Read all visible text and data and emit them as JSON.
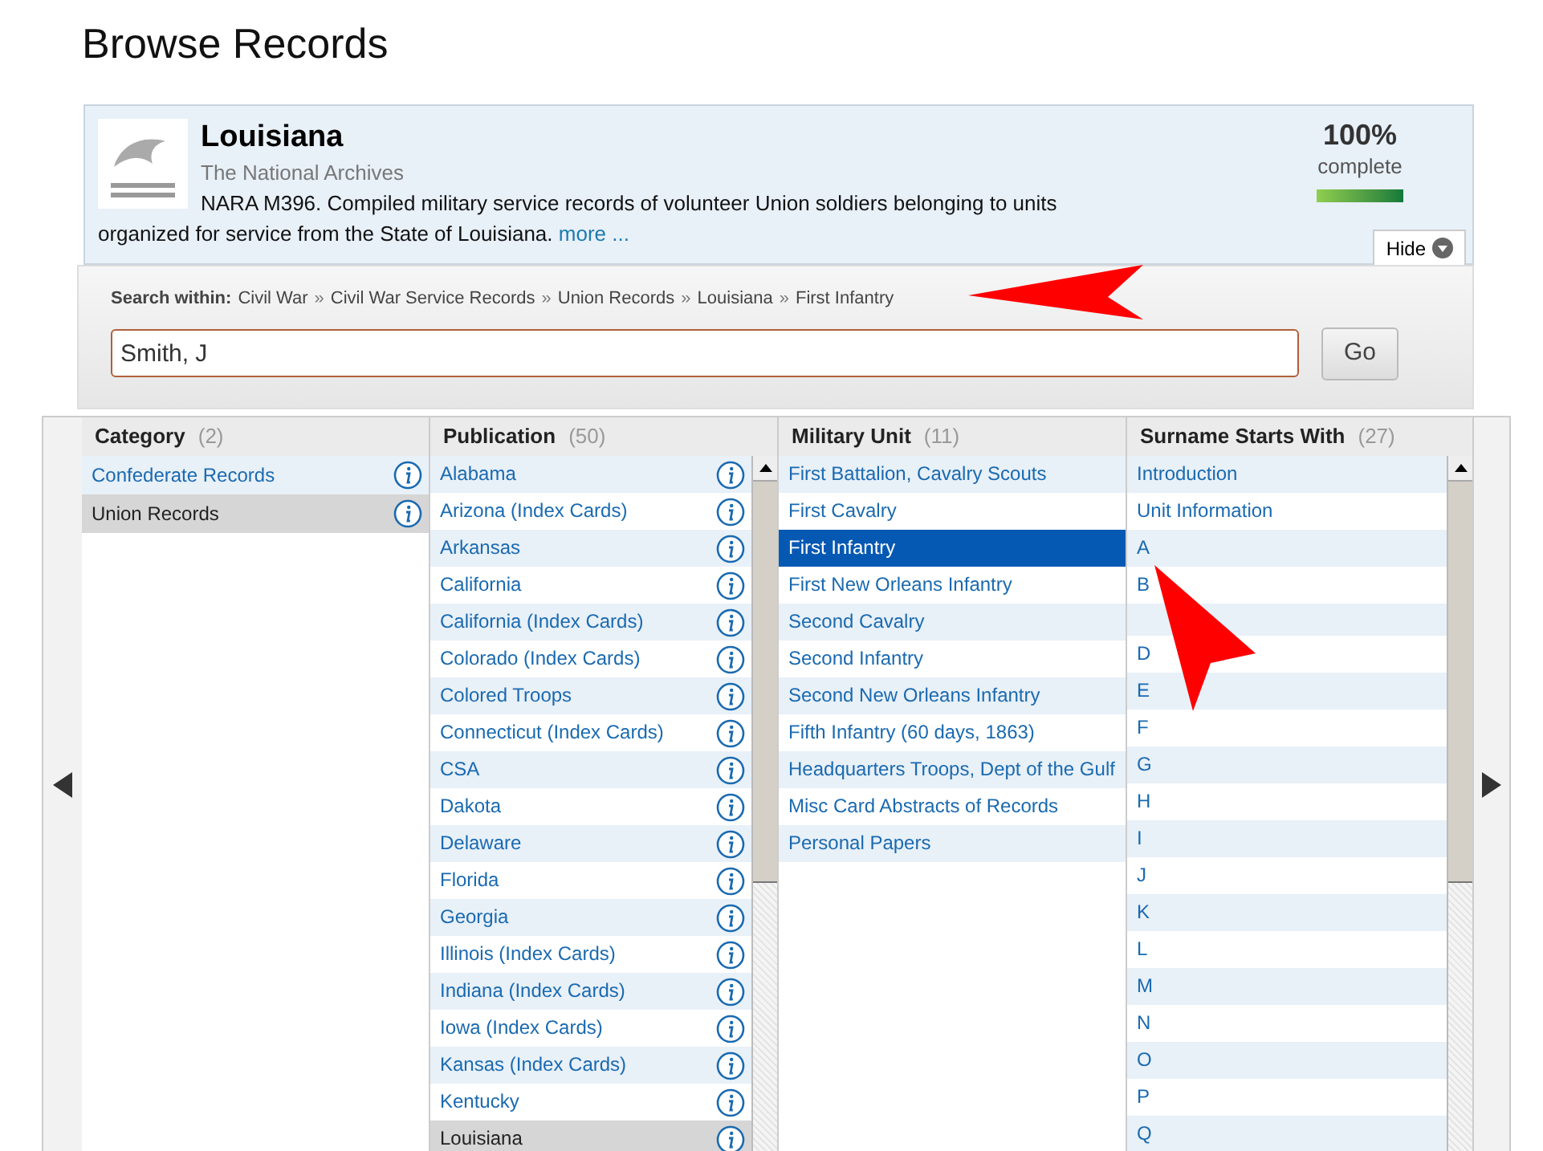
{
  "page_title": "Browse Records",
  "collection": {
    "title": "Louisiana",
    "publisher": "The National Archives",
    "description": "NARA M396. Compiled military service records of volunteer Union soldiers belonging to units organized for service from the State of Louisiana.",
    "more_link": "more ...",
    "percent": "100%",
    "percent_label": "complete",
    "level": 1,
    "hide_button": "Hide"
  },
  "search": {
    "label": "Search within:",
    "breadcrumbs": [
      "Civil War",
      "Civil War Service Records",
      "Union Records",
      "Louisiana",
      "First Infantry"
    ],
    "separator": "»",
    "value": "Smith, J",
    "button": "Go"
  },
  "columns": [
    {
      "title": "Category",
      "count": "(2)",
      "info": true,
      "items": [
        {
          "label": "Confederate Records",
          "selected": false
        },
        {
          "label": "Union Records",
          "selected": true
        }
      ]
    },
    {
      "title": "Publication",
      "count": "(50)",
      "info": true,
      "scrollbar": true,
      "items": [
        {
          "label": "Alabama",
          "selected": false
        },
        {
          "label": "Arizona (Index Cards)",
          "selected": false
        },
        {
          "label": "Arkansas",
          "selected": false
        },
        {
          "label": "California",
          "selected": false
        },
        {
          "label": "California (Index Cards)",
          "selected": false
        },
        {
          "label": "Colorado (Index Cards)",
          "selected": false
        },
        {
          "label": "Colored Troops",
          "selected": false
        },
        {
          "label": "Connecticut (Index Cards)",
          "selected": false
        },
        {
          "label": "CSA",
          "selected": false
        },
        {
          "label": "Dakota",
          "selected": false
        },
        {
          "label": "Delaware",
          "selected": false
        },
        {
          "label": "Florida",
          "selected": false
        },
        {
          "label": "Georgia",
          "selected": false
        },
        {
          "label": "Illinois (Index Cards)",
          "selected": false
        },
        {
          "label": "Indiana (Index Cards)",
          "selected": false
        },
        {
          "label": "Iowa (Index Cards)",
          "selected": false
        },
        {
          "label": "Kansas (Index Cards)",
          "selected": false
        },
        {
          "label": "Kentucky",
          "selected": false
        },
        {
          "label": "Louisiana",
          "selected": true
        }
      ]
    },
    {
      "title": "Military Unit",
      "count": "(11)",
      "info": false,
      "items": [
        {
          "label": "First Battalion, Cavalry Scouts",
          "selected": false
        },
        {
          "label": "First Cavalry",
          "selected": false
        },
        {
          "label": "First Infantry",
          "selected": true
        },
        {
          "label": "First New Orleans Infantry",
          "selected": false
        },
        {
          "label": "Second Cavalry",
          "selected": false
        },
        {
          "label": "Second Infantry",
          "selected": false
        },
        {
          "label": "Second New Orleans Infantry",
          "selected": false
        },
        {
          "label": "Fifth Infantry (60 days, 1863)",
          "selected": false
        },
        {
          "label": "Headquarters Troops, Dept of the Gulf",
          "selected": false
        },
        {
          "label": "Misc Card Abstracts of Records",
          "selected": false
        },
        {
          "label": "Personal Papers",
          "selected": false
        }
      ]
    },
    {
      "title": "Surname Starts With",
      "count": "(27)",
      "info": false,
      "scrollbar": true,
      "items": [
        {
          "label": "Introduction",
          "selected": false
        },
        {
          "label": "Unit Information",
          "selected": false
        },
        {
          "label": "A",
          "selected": false
        },
        {
          "label": "B",
          "selected": false
        },
        {
          "kind": "covered",
          "selected": false
        },
        {
          "label": "D",
          "selected": false
        },
        {
          "label": "E",
          "selected": false
        },
        {
          "label": "F",
          "selected": false
        },
        {
          "label": "G",
          "selected": false
        },
        {
          "label": "H",
          "selected": false
        },
        {
          "label": "I",
          "selected": false
        },
        {
          "label": "J",
          "selected": false
        },
        {
          "label": "K",
          "selected": false
        },
        {
          "label": "L",
          "selected": false
        },
        {
          "label": "M",
          "selected": false
        },
        {
          "label": "N",
          "selected": false
        },
        {
          "label": "O",
          "selected": false
        },
        {
          "label": "P",
          "selected": false
        },
        {
          "label": "Q",
          "selected": false
        }
      ]
    }
  ]
}
